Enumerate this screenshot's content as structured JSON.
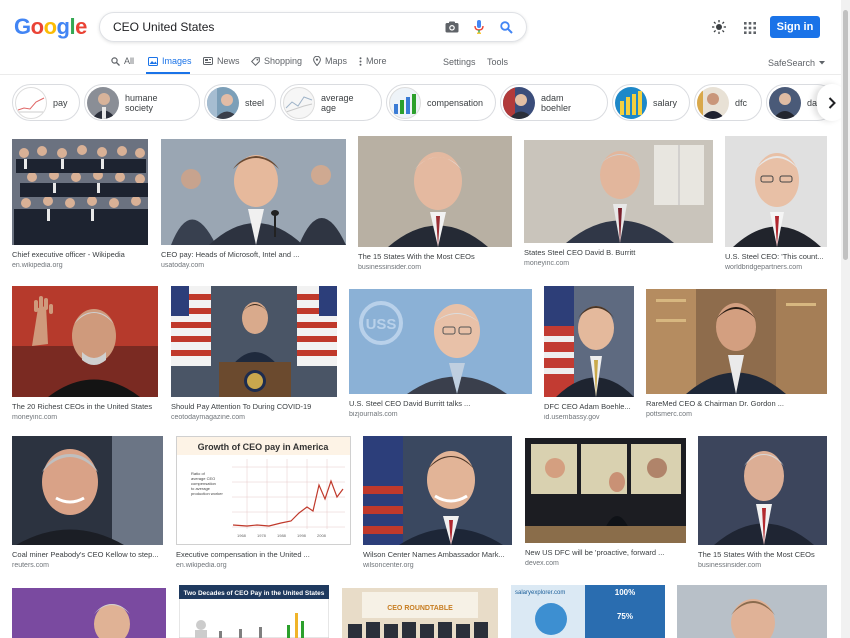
{
  "search": {
    "query": "CEO United States"
  },
  "header": {
    "signin_label": "Sign in"
  },
  "logo": {
    "letters": [
      "G",
      "o",
      "o",
      "g",
      "l",
      "e"
    ],
    "colors": [
      "#4285f4",
      "#ea4335",
      "#fbbc05",
      "#4285f4",
      "#34a853",
      "#ea4335"
    ]
  },
  "tabs": [
    {
      "label": "All",
      "icon": "search-icon"
    },
    {
      "label": "Images",
      "icon": "image-icon"
    },
    {
      "label": "News",
      "icon": "news-icon"
    },
    {
      "label": "Shopping",
      "icon": "tag-icon"
    },
    {
      "label": "Maps",
      "icon": "map-pin-icon"
    },
    {
      "label": "More",
      "icon": "more-vert-icon"
    }
  ],
  "tools": {
    "settings": "Settings",
    "tools": "Tools",
    "safesearch": "SafeSearch"
  },
  "chips": [
    {
      "label": "pay"
    },
    {
      "label": "humane society"
    },
    {
      "label": "steel"
    },
    {
      "label": "average age"
    },
    {
      "label": "compensation"
    },
    {
      "label": "adam boehler"
    },
    {
      "label": "salary"
    },
    {
      "label": "dfc"
    },
    {
      "label": "dav"
    }
  ],
  "results": [
    {
      "caption": "Chief executive officer - Wikipedia",
      "source": "en.wikipedia.org"
    },
    {
      "caption": "CEO pay: Heads of Microsoft, Intel and ...",
      "source": "usatoday.com"
    },
    {
      "caption": "The 15 States With the Most CEOs",
      "source": "businessinsider.com"
    },
    {
      "caption": "States Steel CEO David B. Burritt",
      "source": "moneyinc.com"
    },
    {
      "caption": "U.S. Steel CEO: 'This count...",
      "source": "worldbridgepartners.com"
    },
    {
      "caption": "The 20 Richest CEOs in the United States",
      "source": "moneyinc.com"
    },
    {
      "caption": "Should Pay Attention To During COVID-19",
      "source": "ceotodaymagazine.com"
    },
    {
      "caption": "U.S. Steel CEO David Burritt talks ...",
      "source": "bizjournals.com"
    },
    {
      "caption": "DFC CEO Adam Boehle...",
      "source": "id.usembassy.gov"
    },
    {
      "caption": "RareMed CEO & Chairman Dr. Gordon ...",
      "source": "pottsmerc.com"
    },
    {
      "caption": "Coal miner Peabody's CEO Kellow to step...",
      "source": "reuters.com"
    },
    {
      "caption": "Executive compensation in the United ...",
      "source": "en.wikipedia.org"
    },
    {
      "caption": "Wilson Center Names Ambassador Mark...",
      "source": "wilsoncenter.org"
    },
    {
      "caption": "New US DFC will be 'proactive, forward ...",
      "source": "devex.com"
    },
    {
      "caption": "The 15 States With the Most CEOs",
      "source": "businessinsider.com"
    }
  ],
  "chart_text": {
    "ceo_pay_title": "Growth of CEO pay in America",
    "ceo_pay_ylabel": "Ratio of average CEO compensation to average production worker compensation",
    "two_decades_title": "Two Decades of CEO Pay in the United States",
    "salary_site": "salaryexplorer.com",
    "salary_pct": "100%",
    "salary_pct2": "75%",
    "ceo_roundtable": "CEO ROUNDTABLE"
  }
}
